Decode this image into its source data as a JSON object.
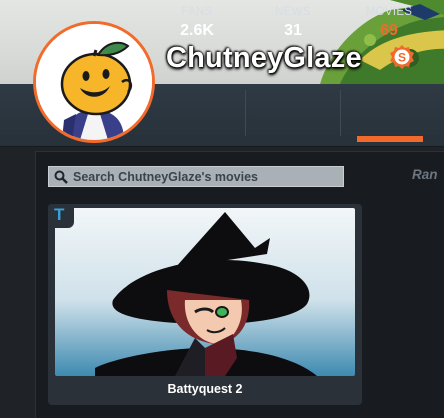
{
  "profile": {
    "username": "ChutneyGlaze",
    "badge_letter": "S",
    "badge_color": "#f16a2c"
  },
  "stats": [
    {
      "label": "FANS",
      "value": "2.6K"
    },
    {
      "label": "NEWS",
      "value": "31"
    },
    {
      "label": "MOVIES",
      "value": "69",
      "active": true
    }
  ],
  "search": {
    "placeholder": "Search ChutneyGlaze's movies"
  },
  "rank_label": "Ran",
  "movies": [
    {
      "title": "Battyquest 2",
      "type_icon": "T"
    }
  ],
  "colors": {
    "accent": "#f16a2c",
    "background": "#1f2328",
    "type_badge": "#3aa0d8"
  }
}
